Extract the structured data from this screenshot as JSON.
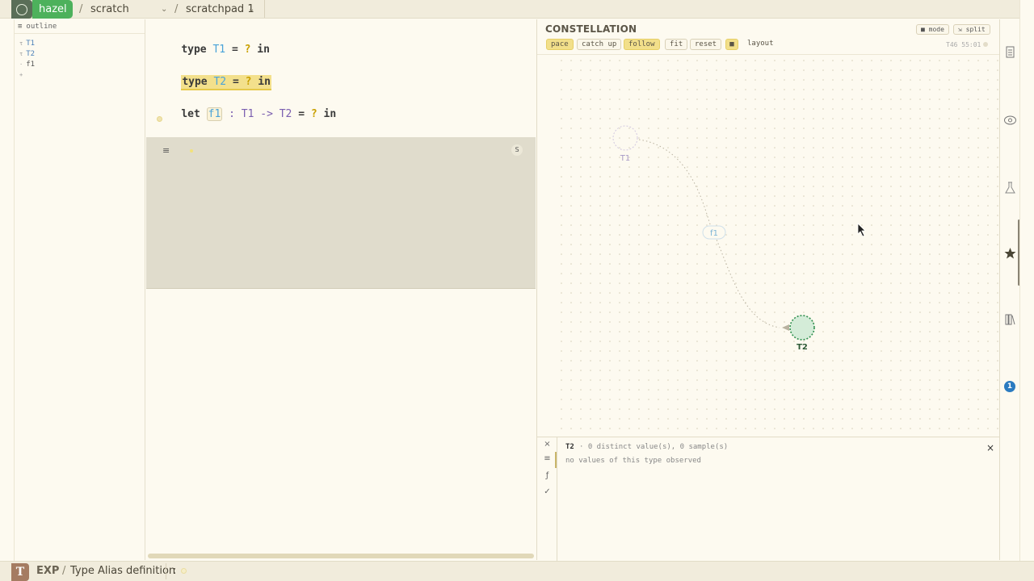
{
  "topbar": {
    "app_name": "hazel",
    "sep": "/",
    "project": "scratch",
    "project_chevron": "⌄",
    "page": "scratchpad 1",
    "page_chevron": "⌄"
  },
  "outline": {
    "header_icon": "≡",
    "title": "outline",
    "items": [
      {
        "kind": "τ",
        "label": "T1"
      },
      {
        "kind": "τ",
        "label": "T2"
      },
      {
        "kind": "·",
        "label": "f1"
      },
      {
        "kind": "+",
        "label": ""
      }
    ]
  },
  "editor": {
    "line1": {
      "kw1": "type",
      "name": "T1",
      "eq": "=",
      "hole": "?",
      "kw2": "in"
    },
    "line2": {
      "kw1": "type",
      "name": "T2",
      "eq": "=",
      "hole": "?",
      "kw2": "in"
    },
    "line3": {
      "kw1": "let",
      "name": "f1",
      "colon": ":",
      "t1": "T1",
      "arrow": "->",
      "t2": "T2",
      "eq": "=",
      "hole": "?",
      "kw2": "in"
    }
  },
  "results": {
    "menu_icon": "≡",
    "s_button": "S"
  },
  "constellation": {
    "title": "CONSTELLATION",
    "mode_btn": "■ mode",
    "split_btn": "⇲ split",
    "pills": [
      "pace",
      "catch up",
      "follow",
      "fit",
      "reset",
      "■",
      "layout"
    ],
    "pills_active": [
      "pace",
      "follow",
      "■"
    ],
    "timer": "T46 55:01",
    "nodes": {
      "t1": "T1",
      "f1": "f1",
      "t2": "T2"
    }
  },
  "inspector": {
    "rail_icons": [
      "×",
      "≡",
      "ƒ",
      "✓"
    ],
    "name": "T2",
    "info": "· 0 distinct value(s), 0 sample(s)",
    "empty": "no values of this type observed",
    "close": "×"
  },
  "right_rail": {
    "icons": [
      "document-icon",
      "eye-icon",
      "flask-icon",
      "star-icon",
      "library-icon"
    ],
    "badge": "1"
  },
  "statusbar": {
    "badge": "T",
    "mode": "EXP",
    "sep": "/",
    "description": "Type Alias definition",
    "colon": ":"
  },
  "colors": {
    "hazel_green": "#4db15c",
    "type_blue": "#4aa3d8",
    "type_purple": "#7b5fb0",
    "hole_gold": "#c9a000",
    "highlight": "#f3e08c",
    "t2_node": "#2f8f4e",
    "badge_blue": "#2b7bc0"
  }
}
